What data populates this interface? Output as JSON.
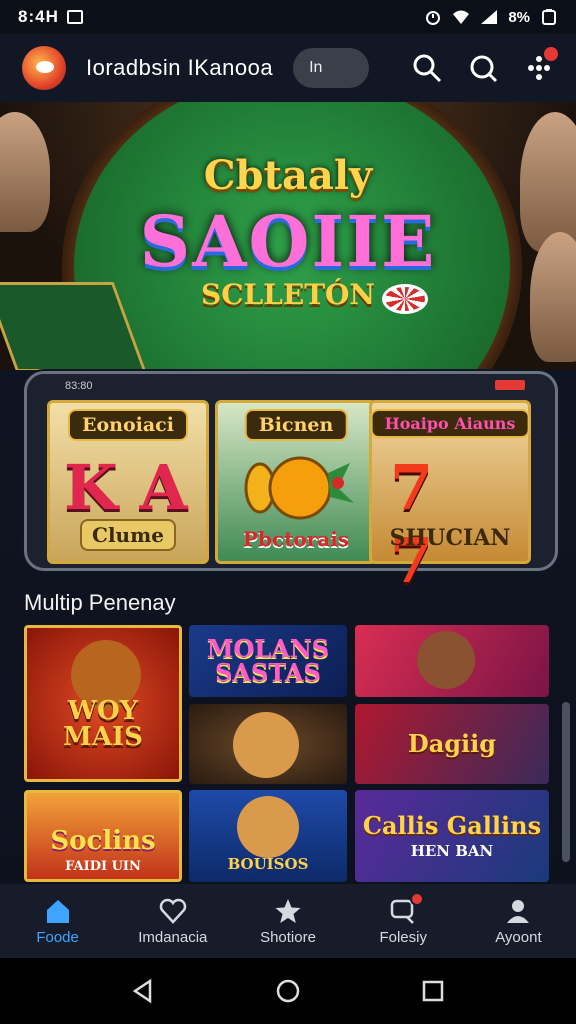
{
  "status_bar": {
    "time": "8:4H",
    "battery": "8%"
  },
  "app": {
    "title": "Ioradbsin IKanooa",
    "language": "In"
  },
  "hero": {
    "line1": "Cbtaaly",
    "line2": "SAOIIE",
    "line3": "SCLLETÓN"
  },
  "featured_slot": {
    "status": "83:80",
    "reels": [
      {
        "title": "Eonoiaci",
        "symbol": "K A",
        "footer": "Clume"
      },
      {
        "title": "Bicnen",
        "symbol": "",
        "footer": "Pbctorais"
      },
      {
        "title": "Hoaipo Aiauns",
        "symbol": "7 7",
        "footer": "SHUCIAN"
      }
    ]
  },
  "section": {
    "title": "Multip Penenay"
  },
  "games": [
    {
      "label": "WOY MAIS"
    },
    {
      "label": "MOLANS SASTAS"
    },
    {
      "label": ""
    },
    {
      "label": ""
    },
    {
      "label": "Dagiig"
    },
    {
      "label": "Soclins",
      "sub": "FAIDI UIN"
    },
    {
      "label": "BOUISOS"
    },
    {
      "label": "Callis Gallins",
      "sub": "HEN BAN"
    }
  ],
  "bottom_nav": [
    {
      "label": "Foode",
      "icon": "home-icon",
      "active": true
    },
    {
      "label": "Imdanacia",
      "icon": "heart-icon",
      "active": false
    },
    {
      "label": "Shotiore",
      "icon": "star-icon",
      "active": false
    },
    {
      "label": "Folesiy",
      "icon": "chat-icon",
      "active": false
    },
    {
      "label": "Ayoont",
      "icon": "account-icon",
      "active": false
    }
  ],
  "colors": {
    "accent": "#3da5ff",
    "badge": "#e53935",
    "gold": "#e7b93f"
  }
}
